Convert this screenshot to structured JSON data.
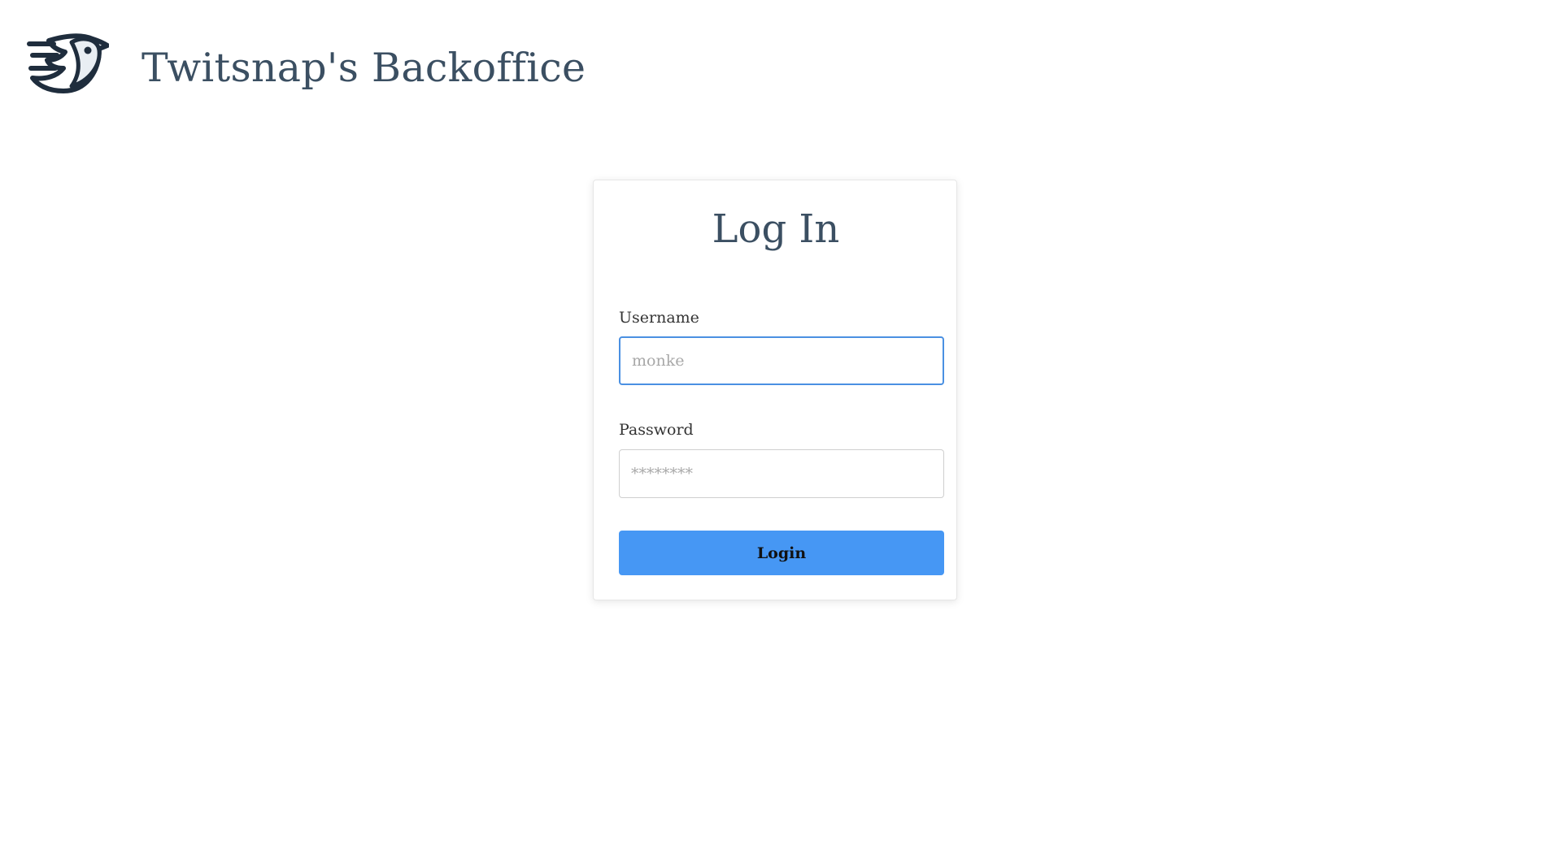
{
  "header": {
    "logo_icon": "bird-logo-icon",
    "title": "Twitsnap's Backoffice"
  },
  "login": {
    "title": "Log In",
    "username": {
      "label": "Username",
      "placeholder": "monke",
      "value": ""
    },
    "password": {
      "label": "Password",
      "placeholder": "********",
      "value": ""
    },
    "submit_label": "Login"
  },
  "colors": {
    "title_text": "#3b4f62",
    "button_bg": "#4697f4",
    "focus_border": "#4a90e2",
    "logo_dark": "#1f2d3d"
  }
}
